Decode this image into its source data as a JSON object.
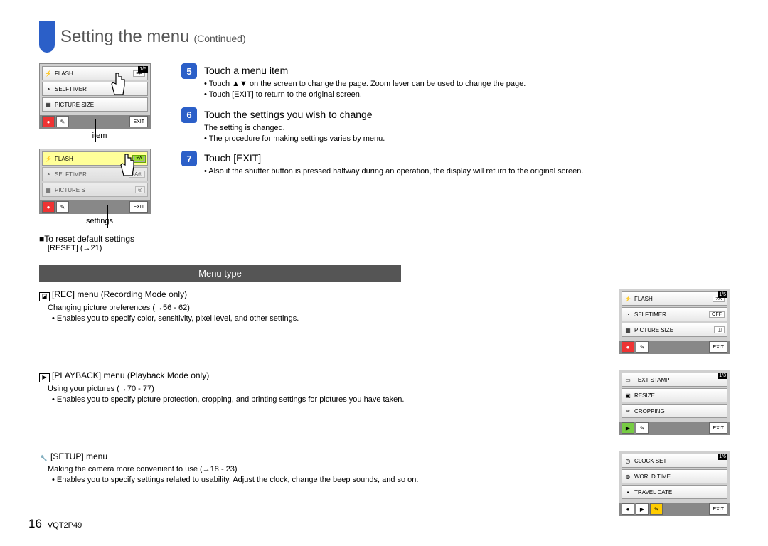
{
  "header": {
    "title": "Setting the menu",
    "continued": "(Continued)"
  },
  "screenA": {
    "row1": "FLASH",
    "row1val": "≠A",
    "row2": "SELFTIMER",
    "row3": "PICTURE SIZE",
    "exit": "EXIT",
    "page": "1/5",
    "caption": "item"
  },
  "screenB": {
    "row1": "FLASH",
    "opt1": "≠A",
    "row2": "SELFTIMER",
    "opt2": "≠A◎",
    "row3": "PICTURE S",
    "opt3": "◎",
    "exit": "EXIT",
    "caption": "settings"
  },
  "reset": {
    "title": "■To reset default settings",
    "sub": "[RESET] (→21)"
  },
  "step5": {
    "num": "5",
    "title": "Touch a menu item",
    "b1": "• Touch ▲▼ on the screen to change the page. Zoom lever can be used to change the page.",
    "b2": "• Touch [EXIT] to return to the original screen."
  },
  "step6": {
    "num": "6",
    "title": "Touch the settings you wish to change",
    "n1": "The setting is changed.",
    "b1": "• The procedure for making settings varies by menu."
  },
  "step7": {
    "num": "7",
    "title": "Touch [EXIT]",
    "b1": "• Also if the shutter button is pressed halfway during an operation, the display will return to the original screen."
  },
  "menutype": "Menu type",
  "rec": {
    "title": "[REC] menu (Recording Mode only)",
    "l1": "Changing picture preferences (→56 - 62)",
    "l2": "• Enables you to specify color, sensitivity, pixel level, and other settings.",
    "s_row1": "FLASH",
    "s_row1v": "≠A",
    "s_row2": "SELFTIMER",
    "s_row2v": "OFF",
    "s_row3": "PICTURE SIZE",
    "s_exit": "EXIT",
    "s_page": "1/5"
  },
  "play": {
    "title": "[PLAYBACK] menu (Playback Mode only)",
    "l1": "Using your pictures (→70 - 77)",
    "l2": "• Enables you to specify picture protection, cropping, and printing settings for pictures you have taken.",
    "s_row1": "TEXT STAMP",
    "s_row2": "RESIZE",
    "s_row3": "CROPPING",
    "s_exit": "EXIT",
    "s_page": "1/3"
  },
  "setup": {
    "title": "[SETUP] menu",
    "l1": "Making the camera more convenient to use (→18 - 23)",
    "l2": "• Enables you to specify settings related to usability. Adjust the clock, change the beep sounds, and so on.",
    "s_row1": "CLOCK SET",
    "s_row2": "WORLD TIME",
    "s_row3": "TRAVEL DATE",
    "s_exit": "EXIT",
    "s_page": "1/6"
  },
  "footer": {
    "page": "16",
    "code": "VQT2P49"
  }
}
